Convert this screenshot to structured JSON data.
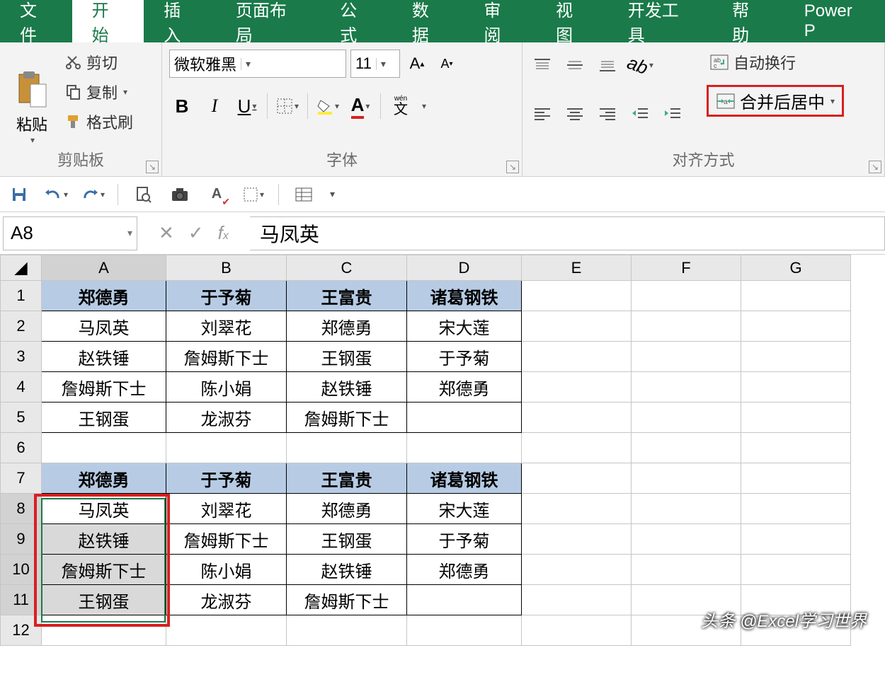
{
  "ribbon_tabs": {
    "file": "文件",
    "home": "开始",
    "insert": "插入",
    "page_layout": "页面布局",
    "formulas": "公式",
    "data": "数据",
    "review": "审阅",
    "view": "视图",
    "dev": "开发工具",
    "help": "帮助",
    "power": "Power P"
  },
  "clipboard": {
    "paste": "粘贴",
    "cut": "剪切",
    "copy": "复制",
    "format_painter": "格式刷",
    "group": "剪贴板"
  },
  "font": {
    "name": "微软雅黑",
    "size": "11",
    "group": "字体",
    "wen": "wén",
    "wen2": "文"
  },
  "alignment": {
    "wrap": "自动换行",
    "merge": "合并后居中",
    "group": "对齐方式"
  },
  "name_box": "A8",
  "formula": "马凤英",
  "columns": [
    "A",
    "B",
    "C",
    "D",
    "E",
    "F",
    "G"
  ],
  "rows": [
    "1",
    "2",
    "3",
    "4",
    "5",
    "6",
    "7",
    "8",
    "9",
    "10",
    "11",
    "12"
  ],
  "t1": {
    "h": [
      "郑德勇",
      "于予菊",
      "王富贵",
      "诸葛钢铁"
    ],
    "r": [
      [
        "马凤英",
        "刘翠花",
        "郑德勇",
        "宋大莲"
      ],
      [
        "赵铁锤",
        "詹姆斯下士",
        "王钢蛋",
        "于予菊"
      ],
      [
        "詹姆斯下士",
        "陈小娟",
        "赵铁锤",
        "郑德勇"
      ],
      [
        "王钢蛋",
        "龙淑芬",
        "詹姆斯下士",
        ""
      ]
    ]
  },
  "t2": {
    "h": [
      "郑德勇",
      "于予菊",
      "王富贵",
      "诸葛钢铁"
    ],
    "r": [
      [
        "马凤英",
        "刘翠花",
        "郑德勇",
        "宋大莲"
      ],
      [
        "赵铁锤",
        "詹姆斯下士",
        "王钢蛋",
        "于予菊"
      ],
      [
        "詹姆斯下士",
        "陈小娟",
        "赵铁锤",
        "郑德勇"
      ],
      [
        "王钢蛋",
        "龙淑芬",
        "詹姆斯下士",
        ""
      ]
    ]
  },
  "watermark": "头条 @Excel学习世界"
}
